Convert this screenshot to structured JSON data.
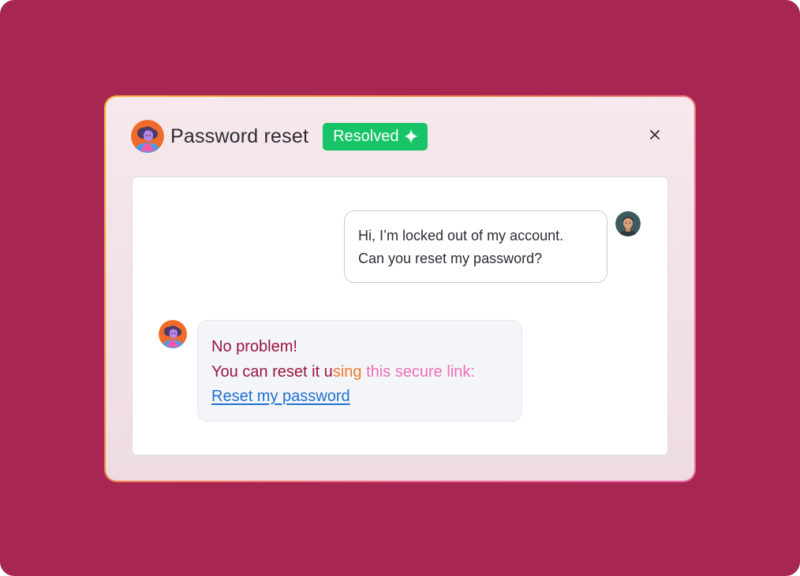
{
  "header": {
    "title": "Password reset",
    "status_badge": "Resolved"
  },
  "conversation": {
    "user_message": {
      "line1": "Hi, I’m locked out of my account.",
      "line2": "Can you reset my password?"
    },
    "agent_message": {
      "line1": "No problem!",
      "line2_part1": "You can reset it u",
      "line2_part2": "sing ",
      "line2_part3": "this secure link:",
      "link_text": "Reset my password"
    }
  },
  "colors": {
    "background": "#a72652",
    "status_green": "#17c468",
    "link_blue": "#1c6fd0",
    "text_crimson": "#98153f",
    "text_orange": "#ef7a2f",
    "text_pink": "#ee6fb8"
  },
  "icons": {
    "close": "close-icon",
    "sparkle": "sparkle-icon",
    "agent_avatar": "agent-avatar",
    "user_avatar": "user-avatar"
  }
}
